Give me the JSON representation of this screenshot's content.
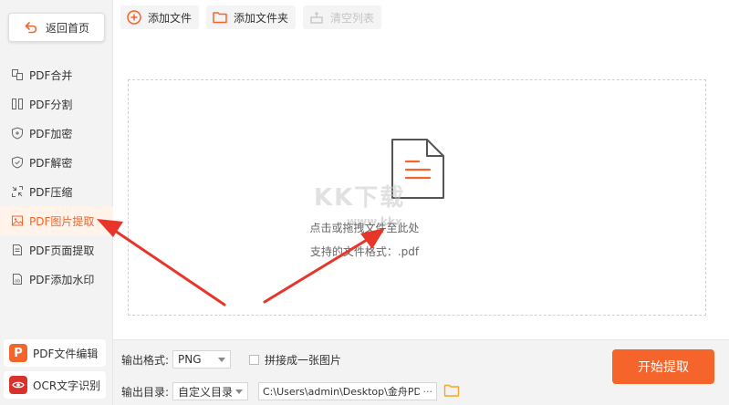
{
  "sidebar": {
    "back_label": "返回首页",
    "items": [
      {
        "label": "PDF合并",
        "icon": "merge-icon",
        "active": false
      },
      {
        "label": "PDF分割",
        "icon": "split-icon",
        "active": false
      },
      {
        "label": "PDF加密",
        "icon": "lock-shield-icon",
        "active": false
      },
      {
        "label": "PDF解密",
        "icon": "unlock-shield-icon",
        "active": false
      },
      {
        "label": "PDF压缩",
        "icon": "compress-icon",
        "active": false
      },
      {
        "label": "PDF图片提取",
        "icon": "image-icon",
        "active": true
      },
      {
        "label": "PDF页面提取",
        "icon": "page-icon",
        "active": false
      },
      {
        "label": "PDF添加水印",
        "icon": "watermark-icon",
        "active": false
      }
    ],
    "apps": [
      {
        "label": "PDF文件编辑",
        "icon": "pdf-editor-icon",
        "color": "#f5642a"
      },
      {
        "label": "OCR文字识别",
        "icon": "ocr-eye-icon",
        "color": "#d9322b"
      }
    ]
  },
  "toolbar": {
    "add_file": "添加文件",
    "add_folder": "添加文件夹",
    "clear_list": "清空列表"
  },
  "dropzone": {
    "hint": "点击或拖拽文件至此处",
    "formats": "支持的文件格式：.pdf"
  },
  "watermark": {
    "text": "KK下载",
    "url": "www.kkx"
  },
  "bottom": {
    "format_label": "输出格式:",
    "format_value": "PNG",
    "merge_label": "拼接成一张图片",
    "dir_label": "输出目录:",
    "dir_value": "自定义目录",
    "path": "C:\\Users\\admin\\Desktop\\金舟PDF转换",
    "more": "···",
    "start": "开始提取"
  },
  "colors": {
    "accent": "#f5642a",
    "arrow": "#e8352a"
  }
}
